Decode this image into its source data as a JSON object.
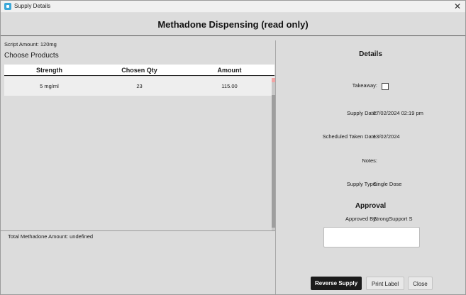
{
  "window": {
    "title": "Supply Details"
  },
  "header": {
    "title": "Methadone Dispensing (read only)"
  },
  "left": {
    "script_amount": "Script Amount: 120mg",
    "choose_products": "Choose Products",
    "columns": [
      "Strength",
      "Chosen Qty",
      "Amount"
    ],
    "rows": [
      {
        "strength": "5 mg/ml",
        "qty": "23",
        "amount": "115.00"
      }
    ],
    "total": "Total Methadone Amount: undefined"
  },
  "details": {
    "title": "Details",
    "takeaway_label": "Takeaway:",
    "takeaway_checked": false,
    "supply_date_label": "Supply Date:",
    "supply_date": "27/02/2024 02:19 pm",
    "scheduled_label": "Scheduled Taken Date:",
    "scheduled_date": "13/02/2024",
    "notes_label": "Notes:",
    "notes": "",
    "supply_type_label": "Supply Type:",
    "supply_type": "Single Dose"
  },
  "approval": {
    "title": "Approval",
    "approved_by_label": "Approved By:",
    "approved_by": "StrongSupport S"
  },
  "buttons": {
    "reverse": "Reverse Supply",
    "print": "Print Label",
    "close": "Close"
  },
  "icons": {
    "app": "app-icon",
    "close": "close-icon"
  }
}
